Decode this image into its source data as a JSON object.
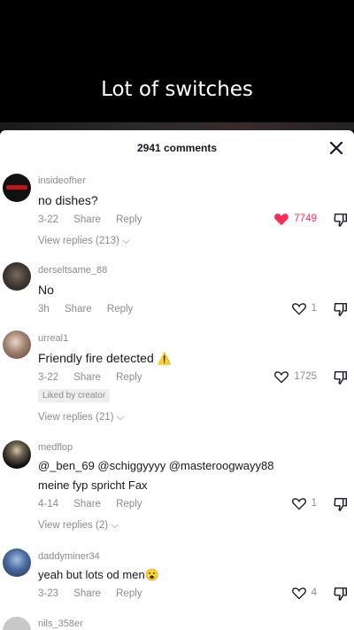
{
  "video": {
    "title": "Lot of switches"
  },
  "header": {
    "count_label": "2941 comments"
  },
  "comments": [
    {
      "username": "insideofher",
      "text": "no dishes?",
      "date": "3-22",
      "share": "Share",
      "reply": "Reply",
      "likes": "7749",
      "liked": true,
      "replies": "View replies (213)"
    },
    {
      "username": "derseltsame_88",
      "text": "No",
      "date": "3h",
      "share": "Share",
      "reply": "Reply",
      "likes": "1",
      "liked": false
    },
    {
      "username": "urreal1",
      "text": "Friendly fire detected",
      "emoji": "⚠️",
      "date": "3-22",
      "share": "Share",
      "reply": "Reply",
      "likes": "1725",
      "liked": false,
      "badge": "Liked by creator",
      "replies": "View replies (21)"
    },
    {
      "username": "medflop",
      "text": "@_ben_69 @schiggyyyy @masteroogwayy88",
      "text2": "meine fyp spricht Fax",
      "date": "4-14",
      "share": "Share",
      "reply": "Reply",
      "likes": "1",
      "liked": false,
      "replies": "View replies (2)"
    },
    {
      "username": "daddyminer34",
      "text": "yeah but lots od men",
      "emoji": "😮",
      "date": "3-23",
      "share": "Share",
      "reply": "Reply",
      "likes": "4",
      "liked": false
    },
    {
      "username": "nils_358er"
    }
  ],
  "colors": {
    "like_red": "#fe2c55",
    "muted": "#8a8b91",
    "text": "#161823"
  }
}
